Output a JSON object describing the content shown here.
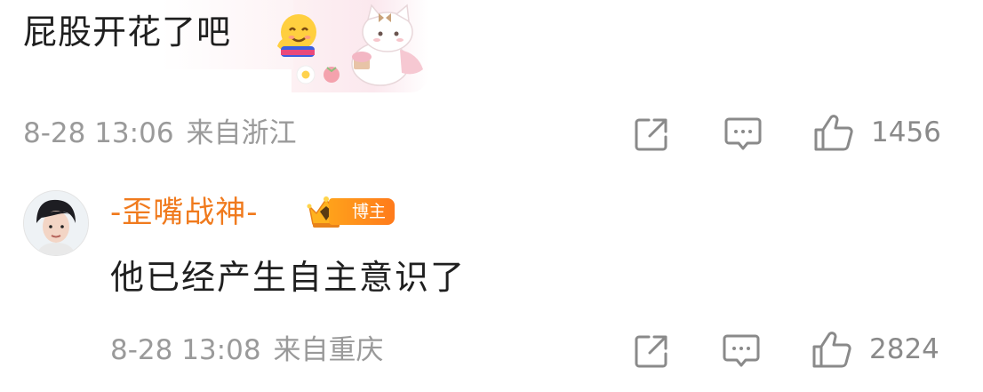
{
  "comments": [
    {
      "text": "屁股开花了吧",
      "emoji": "hug-emoji",
      "sticker": "cat-sticker",
      "time": "8-28 13:06",
      "location": "来自浙江",
      "likes": "1456",
      "icons": {
        "share": "share-icon",
        "reply": "comment-icon",
        "like": "thumbs-up-icon"
      }
    },
    {
      "username": "-歪嘴战神-",
      "badge": "博主",
      "text": "他已经产生自主意识了",
      "time": "8-28 13:08",
      "location": "来自重庆",
      "likes": "2824",
      "icons": {
        "share": "share-icon",
        "reply": "comment-icon",
        "like": "thumbs-up-icon"
      }
    }
  ],
  "colors": {
    "username": "#f07a1d",
    "meta_text": "#9a9a9a",
    "body_text": "#1f1f1f",
    "badge": "#ff8c1b"
  }
}
